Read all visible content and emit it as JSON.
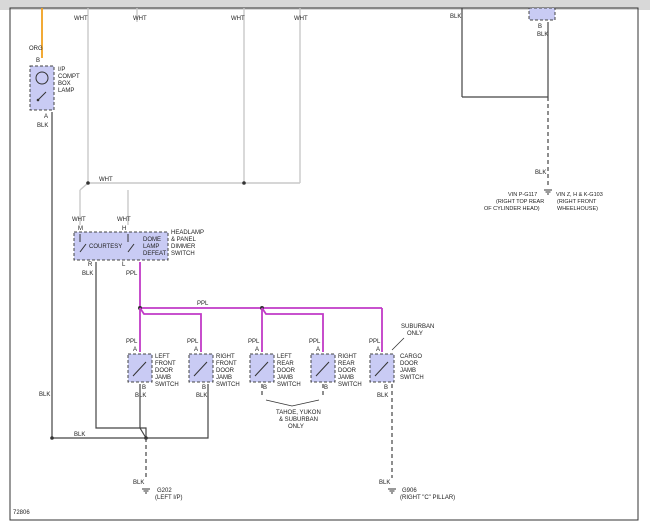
{
  "figure_id": "72806",
  "wire_colors": {
    "ORG": "#f0a020",
    "PPL": "#c13ac7",
    "WHT": "#c9c9c9",
    "BLK": "#444444"
  },
  "wht_tags": [
    "WHT",
    "WHT",
    "WHT",
    "WHT"
  ],
  "blk_top_right": "BLK",
  "ip_lamp": {
    "color_in": "ORG",
    "pin_b": "B",
    "lines": [
      "I/P",
      "COMPT",
      "BOX",
      "LAMP"
    ],
    "pin_a": "A",
    "color_out": "BLK"
  },
  "wht_bus": "WHT",
  "headlamp_switch": {
    "wire_m": "WHT",
    "wire_h": "WHT",
    "pin_m": "M",
    "pin_h": "H",
    "courtesy": "COURTESY",
    "dome": [
      "DOME",
      "LAMP",
      "DEFEAT"
    ],
    "title": [
      "HEADLAMP",
      "& PANEL",
      "DIMMER",
      "SWITCH"
    ],
    "pin_r": "R",
    "pin_l": "L",
    "out_r": "BLK",
    "out_l": "PPL"
  },
  "ppl_bus": "PPL",
  "switches": [
    {
      "lines": [
        "LEFT",
        "FRONT",
        "DOOR",
        "JAMB",
        "SWITCH"
      ],
      "wire_in": "PPL",
      "pin_a": "A",
      "pin_b": "B",
      "wire_out": "BLK"
    },
    {
      "lines": [
        "RIGHT",
        "FRONT",
        "DOOR",
        "JAMB",
        "SWITCH"
      ],
      "wire_in": "PPL",
      "pin_a": "A",
      "pin_b": "B",
      "wire_out": "BLK"
    },
    {
      "lines": [
        "LEFT",
        "REAR",
        "DOOR",
        "JAMB",
        "SWITCH"
      ],
      "wire_in": "PPL",
      "pin_a": "A",
      "pin_b": "B",
      "wire_out": "BLK"
    },
    {
      "lines": [
        "RIGHT",
        "REAR",
        "DOOR",
        "JAMB",
        "SWITCH"
      ],
      "wire_in": "PPL",
      "pin_a": "A",
      "pin_b": "B",
      "wire_out": "BLK"
    },
    {
      "lines": [
        "CARGO",
        "DOOR",
        "JAMB",
        "SWITCH"
      ],
      "wire_in": "PPL",
      "pin_a": "A",
      "pin_b": "B",
      "wire_out": "BLK"
    }
  ],
  "suburban_only": [
    "SUBURBAN",
    "ONLY"
  ],
  "tahoe_note": [
    "TAHOE, YUKON",
    "& SUBURBAN",
    "ONLY"
  ],
  "left_blk": [
    "BLK",
    "BLK"
  ],
  "right_blk": "BLK",
  "grounds": [
    {
      "wire": "BLK",
      "name": "G202",
      "loc": "(LEFT I/P)"
    },
    {
      "wire": "BLK",
      "name": "G906",
      "loc": "(RIGHT \"C\" PILLAR)"
    }
  ],
  "vin_p": [
    "VIN P-G117",
    "(RIGHT TOP REAR",
    "OF CYLINDER HEAD)"
  ],
  "vin_z": [
    "VIN Z, H & K-G103",
    "(RIGHT FRONT",
    "WHEELHOUSE)"
  ],
  "right_blk_labels": [
    "BLK",
    "BLK"
  ]
}
